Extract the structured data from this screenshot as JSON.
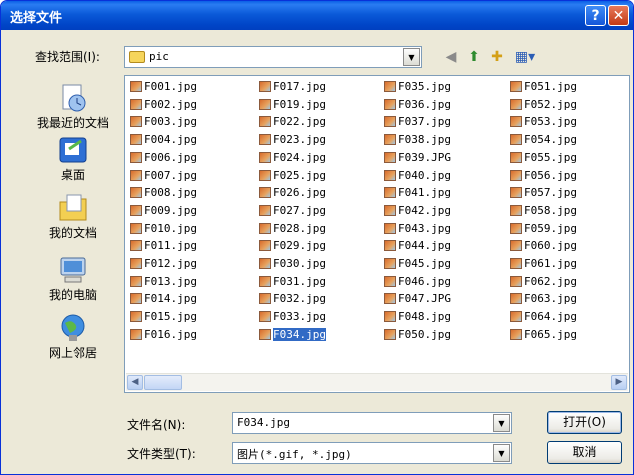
{
  "window": {
    "title": "选择文件"
  },
  "title_buttons": {
    "help": "?",
    "close": "✕"
  },
  "look_in": {
    "label": "查找范围(I):",
    "value": "pic"
  },
  "places": [
    {
      "label": "我最近的文档",
      "icon": "recent-documents-icon"
    },
    {
      "label": "桌面",
      "icon": "desktop-icon"
    },
    {
      "label": "我的文档",
      "icon": "my-documents-icon"
    },
    {
      "label": "我的电脑",
      "icon": "my-computer-icon"
    },
    {
      "label": "网上邻居",
      "icon": "network-places-icon"
    }
  ],
  "files": [
    [
      "F001.jpg",
      "F002.jpg",
      "F003.jpg",
      "F004.jpg",
      "F006.jpg",
      "F007.jpg",
      "F008.jpg",
      "F009.jpg",
      "F010.jpg",
      "F011.jpg",
      "F012.jpg",
      "F013.jpg",
      "F014.jpg",
      "F015.jpg",
      "F016.jpg"
    ],
    [
      "F017.jpg",
      "F019.jpg",
      "F022.jpg",
      "F023.jpg",
      "F024.jpg",
      "F025.jpg",
      "F026.jpg",
      "F027.jpg",
      "F028.jpg",
      "F029.jpg",
      "F030.jpg",
      "F031.jpg",
      "F032.jpg",
      "F033.jpg",
      "F034.jpg"
    ],
    [
      "F035.jpg",
      "F036.jpg",
      "F037.jpg",
      "F038.jpg",
      "F039.JPG",
      "F040.jpg",
      "F041.jpg",
      "F042.jpg",
      "F043.jpg",
      "F044.jpg",
      "F045.jpg",
      "F046.jpg",
      "F047.JPG",
      "F048.jpg",
      "F050.jpg"
    ],
    [
      "F051.jpg",
      "F052.jpg",
      "F053.jpg",
      "F054.jpg",
      "F055.jpg",
      "F056.jpg",
      "F057.jpg",
      "F058.jpg",
      "F059.jpg",
      "F060.jpg",
      "F061.jpg",
      "F062.jpg",
      "F063.jpg",
      "F064.jpg",
      "F065.jpg"
    ]
  ],
  "selected_file": "F034.jpg",
  "filename": {
    "label": "文件名(N):",
    "value": "F034.jpg"
  },
  "filetype": {
    "label": "文件类型(T):",
    "value": "图片(*.gif, *.jpg)"
  },
  "buttons": {
    "open": "打开(O)",
    "cancel": "取消"
  },
  "colors": {
    "title_bar": "#0b5ad9",
    "selection": "#316ac5",
    "dialog_bg": "#ece9d8"
  }
}
